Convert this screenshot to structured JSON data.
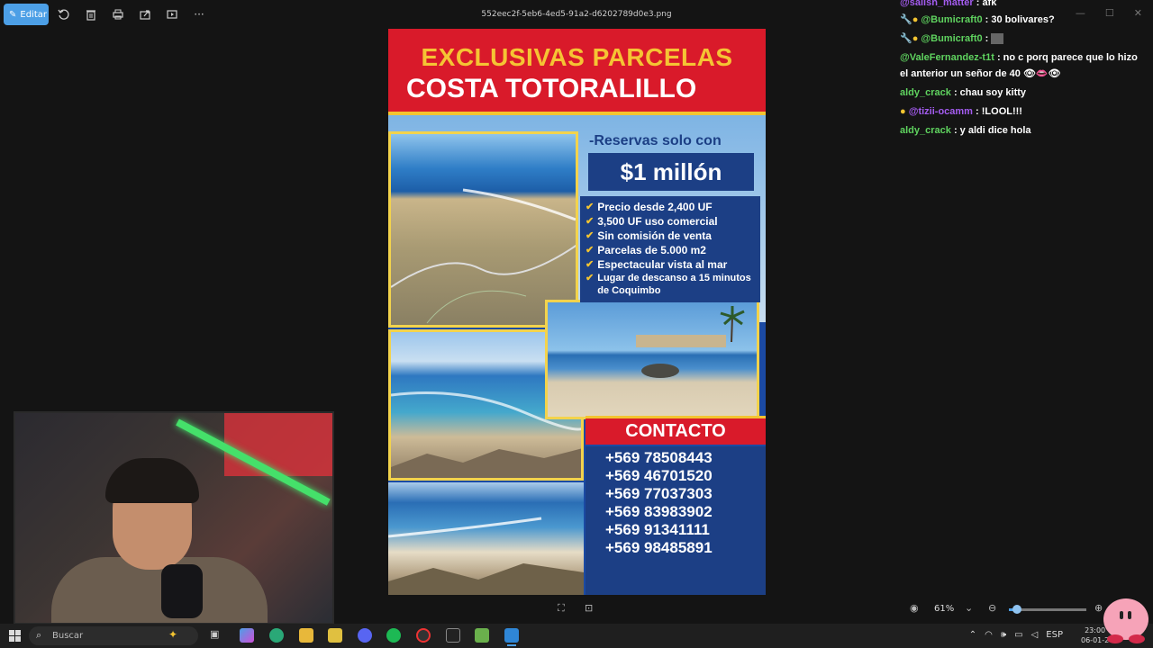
{
  "toolbar": {
    "edit_label": "Editar",
    "filename": "552eec2f-5eb6-4ed5-91a2-d6202789d0e3.png"
  },
  "poster": {
    "title_line1": "EXCLUSIVAS PARCELAS",
    "title_line2": "COSTA TOTORALILLO",
    "reserve_text": "-Reservas solo con",
    "price": "$1 millón",
    "features": [
      "Precio desde 2,400 UF",
      "3,500 UF uso comercial",
      "Sin comisión de venta",
      "Parcelas de 5.000 m2",
      "Espectacular vista al mar",
      "Lugar de descanso a 15 minutos de Coquimbo"
    ],
    "contact_title": "CONTACTO",
    "phones": [
      "+569 78508443",
      "+569 46701520",
      "+569 77037303",
      "+569 83983902",
      "+569 91341111",
      "+569 98485891"
    ]
  },
  "chat": {
    "messages": [
      {
        "user": "@sallsh_matter",
        "text": ": afk"
      },
      {
        "user": "@Bumicraft0",
        "text": ": 30 bolivares?"
      },
      {
        "user": "@Bumicraft0",
        "text": ":"
      },
      {
        "user": "@ValeFernandez-t1t",
        "text": ": no c porq parece que lo hizo el anterior un señor de 40"
      },
      {
        "user": "aldy_crack",
        "text": ": chau soy kitty"
      },
      {
        "user": "@tizii-ocamm",
        "text": ": !LOOL!!!"
      },
      {
        "user": "aldy_crack",
        "text": ": y aldi dice hola"
      }
    ]
  },
  "viewer": {
    "zoom": "61%",
    "zoom_fraction": 0.1
  },
  "taskbar": {
    "search_placeholder": "Buscar",
    "language": "ESP",
    "time": "23:00",
    "date": "06-01-2"
  },
  "colors": {
    "accent": "#4c9fe6",
    "poster_red": "#d91a2a",
    "poster_blue": "#1c3f85",
    "poster_yellow": "#f3c431",
    "chat_user_green": "#5fd35f",
    "chat_user_purple": "#a45cf0"
  }
}
